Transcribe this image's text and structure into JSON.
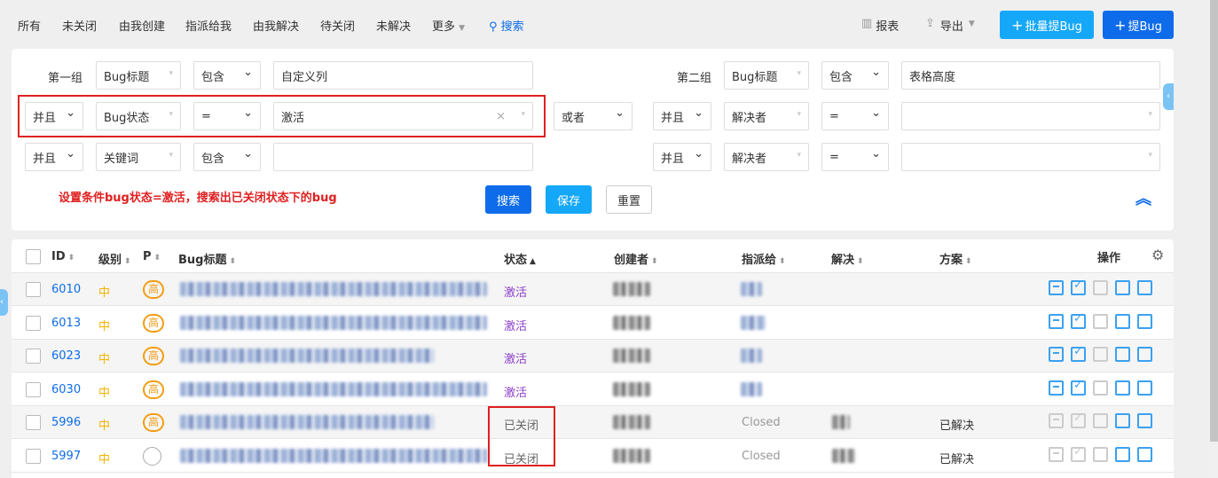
{
  "nav": {
    "tabs": [
      "所有",
      "未关闭",
      "由我创建",
      "指派给我",
      "由我解决",
      "待关闭",
      "未解决",
      "更多"
    ],
    "search": "搜索"
  },
  "toolbar": {
    "report": "报表",
    "export": "导出",
    "batch_create": "批量提Bug",
    "create": "提Bug"
  },
  "search": {
    "group1": "第一组",
    "group2": "第二组",
    "rows1": [
      {
        "logic": "",
        "field": "Bug标题",
        "op": "包含",
        "value": "自定义列"
      },
      {
        "logic": "并且",
        "field": "Bug状态",
        "op": "=",
        "value": "激活"
      },
      {
        "logic": "并且",
        "field": "关键词",
        "op": "包含",
        "value": ""
      }
    ],
    "group_logic": "或者",
    "rows2": [
      {
        "logic": "",
        "field": "Bug标题",
        "op": "包含",
        "value": "表格高度"
      },
      {
        "logic": "并且",
        "field": "解决者",
        "op": "=",
        "value": ""
      },
      {
        "logic": "并且",
        "field": "解决者",
        "op": "=",
        "value": ""
      }
    ],
    "annotation": "设置条件bug状态=激活，搜索出已关闭状态下的bug",
    "search_btn": "搜索",
    "save_btn": "保存",
    "reset_btn": "重置"
  },
  "table": {
    "headers": [
      "ID",
      "级别",
      "P",
      "Bug标题",
      "状态",
      "创建者",
      "指派给",
      "解决",
      "方案",
      "操作"
    ],
    "rows": [
      {
        "id": "6010",
        "level": "中",
        "pri": "高",
        "status": "激活",
        "assigned": "",
        "resolution": ""
      },
      {
        "id": "6013",
        "level": "中",
        "pri": "高",
        "status": "激活",
        "assigned": "",
        "resolution": ""
      },
      {
        "id": "6023",
        "level": "中",
        "pri": "高",
        "status": "激活",
        "assigned": "",
        "resolution": ""
      },
      {
        "id": "6030",
        "level": "中",
        "pri": "高",
        "status": "激活",
        "assigned": "",
        "resolution": ""
      },
      {
        "id": "5996",
        "level": "中",
        "pri": "高",
        "status": "已关闭",
        "assigned": "Closed",
        "resolution": "已解决"
      },
      {
        "id": "5997",
        "level": "中",
        "pri": "",
        "status": "已关闭",
        "assigned": "Closed",
        "resolution": "已解决"
      }
    ]
  },
  "colors": {
    "primary": "#0e6cea",
    "light_primary": "#16a8f8",
    "active": "#8b3fc9",
    "red": "#e02020"
  }
}
